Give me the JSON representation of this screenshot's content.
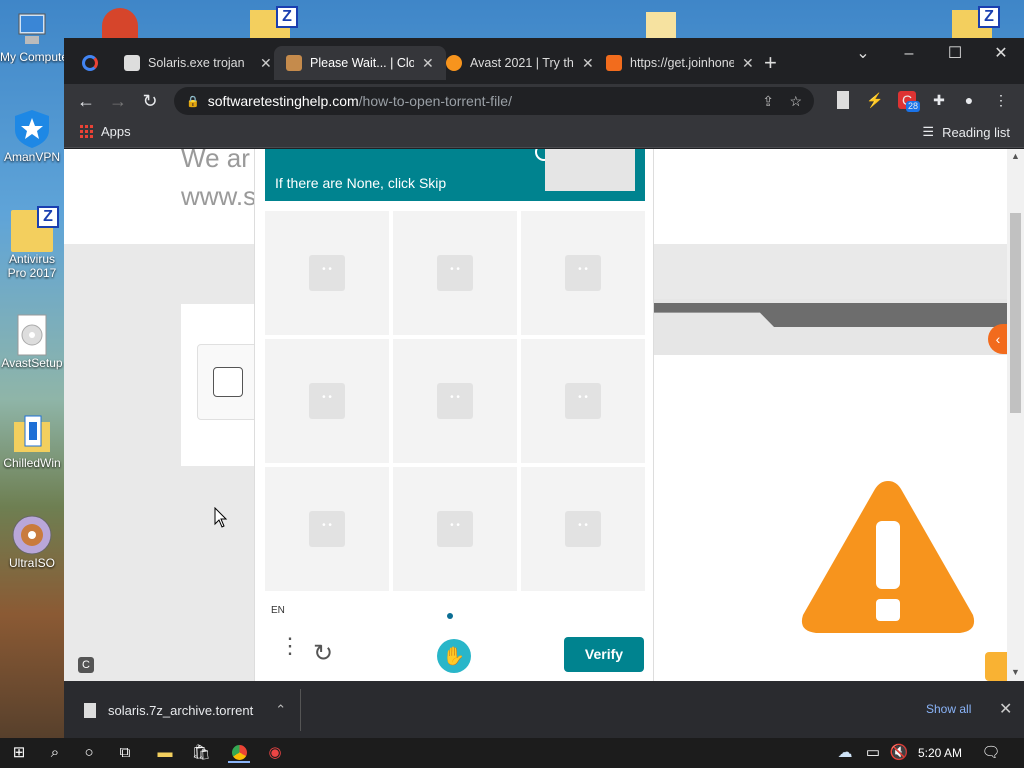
{
  "desktop": {
    "icons": [
      {
        "label": "My Computer"
      },
      {
        "label": "AmanVPN"
      },
      {
        "label": "Antivirus Pro 2017"
      },
      {
        "label": "AvastSetup"
      },
      {
        "label": "ChilledWin"
      },
      {
        "label": "UltraISO"
      }
    ]
  },
  "browser": {
    "tabs": [
      {
        "title": "Solaris.exe trojan",
        "icon": "museum-icon"
      },
      {
        "title": "Please Wait... | Cloudflare",
        "icon": "cloudflare-icon",
        "active": true
      },
      {
        "title": "Avast 2021 | Try th",
        "icon": "avast-icon"
      },
      {
        "title": "https://get.joinhoney",
        "icon": "honey-icon"
      }
    ],
    "url_domain": "softwaretestinghelp.com",
    "url_path": "/how-to-open-torrent-file/",
    "bookmarks_apps": "Apps",
    "reading_list": "Reading list",
    "ext_badge": "28"
  },
  "page": {
    "heading_line1": "We ar",
    "heading_line2": "www.s"
  },
  "captcha": {
    "instruction": "If there are None, click Skip",
    "lang": "EN",
    "verify_label": "Verify",
    "tiles": 9
  },
  "downloads": {
    "filename": "solaris.7z_archive.torrent",
    "show_all": "Show all"
  },
  "taskbar": {
    "time": "5:20 AM"
  },
  "colors": {
    "accent": "#00838f",
    "warning": "#f7941d"
  }
}
